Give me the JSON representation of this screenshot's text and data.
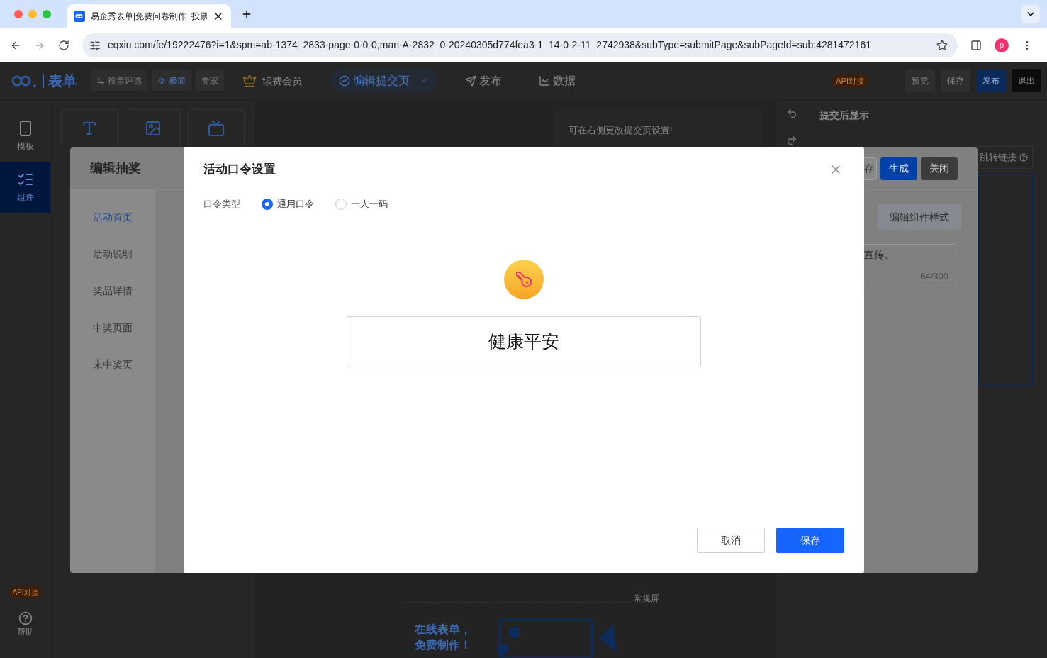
{
  "browser": {
    "tab_title": "易企秀表单|免费问卷制作_投票",
    "url": "eqxiu.com/fe/19222476?i=1&spm=ab-1374_2833-page-0-0-0,man-A-2832_0-20240305d774fea3-1_14-0-2-11_2742938&subType=submitPage&subPageId=sub:4281472161",
    "profile_initial": "p"
  },
  "header": {
    "logo_text": "表单",
    "mode_buttons": [
      {
        "label": "投票评选",
        "kind": "scene"
      },
      {
        "label": "极简",
        "kind": "mode",
        "selected": true
      },
      {
        "label": "专家",
        "kind": "mode",
        "selected": false
      }
    ],
    "member": "续费会员",
    "nav": [
      {
        "label": "编辑提交页",
        "kind": "dropdown",
        "selected": true
      },
      {
        "label": "发布",
        "kind": "send",
        "selected": false
      },
      {
        "label": "数据",
        "kind": "chart",
        "selected": false
      }
    ],
    "api_badge": "API对接",
    "actions": [
      {
        "label": "预览",
        "kind": "plain"
      },
      {
        "label": "保存",
        "kind": "plain"
      },
      {
        "label": "发布",
        "kind": "primary"
      },
      {
        "label": "退出",
        "kind": "dark"
      }
    ]
  },
  "sidebar": {
    "items": [
      {
        "label": "模板",
        "kind": "phone",
        "selected": false
      },
      {
        "label": "组件",
        "kind": "form",
        "selected": true
      }
    ],
    "api_badge": "API对接",
    "help": "帮助"
  },
  "canvas": {
    "tip": "可在右侧更改提交页设置!",
    "screen_label": "常规屏",
    "banner": [
      "在线表单，",
      "免费制作！"
    ]
  },
  "right_panel": {
    "title": "提交后显示",
    "tab": "跳转链接"
  },
  "lottery": {
    "title": "编辑抽奖",
    "nav": [
      {
        "label": "活动首页",
        "selected": true
      },
      {
        "label": "活动说明",
        "selected": false
      },
      {
        "label": "奖品详情",
        "selected": false
      },
      {
        "label": "中奖页面",
        "selected": false
      },
      {
        "label": "未中奖页",
        "selected": false
      }
    ],
    "buttons": [
      {
        "label": "存",
        "kind": "outline"
      },
      {
        "label": "生成",
        "kind": "primary"
      },
      {
        "label": "关闭",
        "kind": "dark"
      }
    ],
    "style_button": "编辑组件样式",
    "text_value": "宣传。",
    "counter": "64/300"
  },
  "dialog": {
    "title": "活动口令设置",
    "type_label": "口令类型",
    "options": [
      {
        "label": "通用口令",
        "selected": true
      },
      {
        "label": "一人一码",
        "selected": false
      }
    ],
    "password": "健康平安",
    "buttons": [
      {
        "label": "取消",
        "kind": "default"
      },
      {
        "label": "保存",
        "kind": "primary"
      }
    ]
  }
}
